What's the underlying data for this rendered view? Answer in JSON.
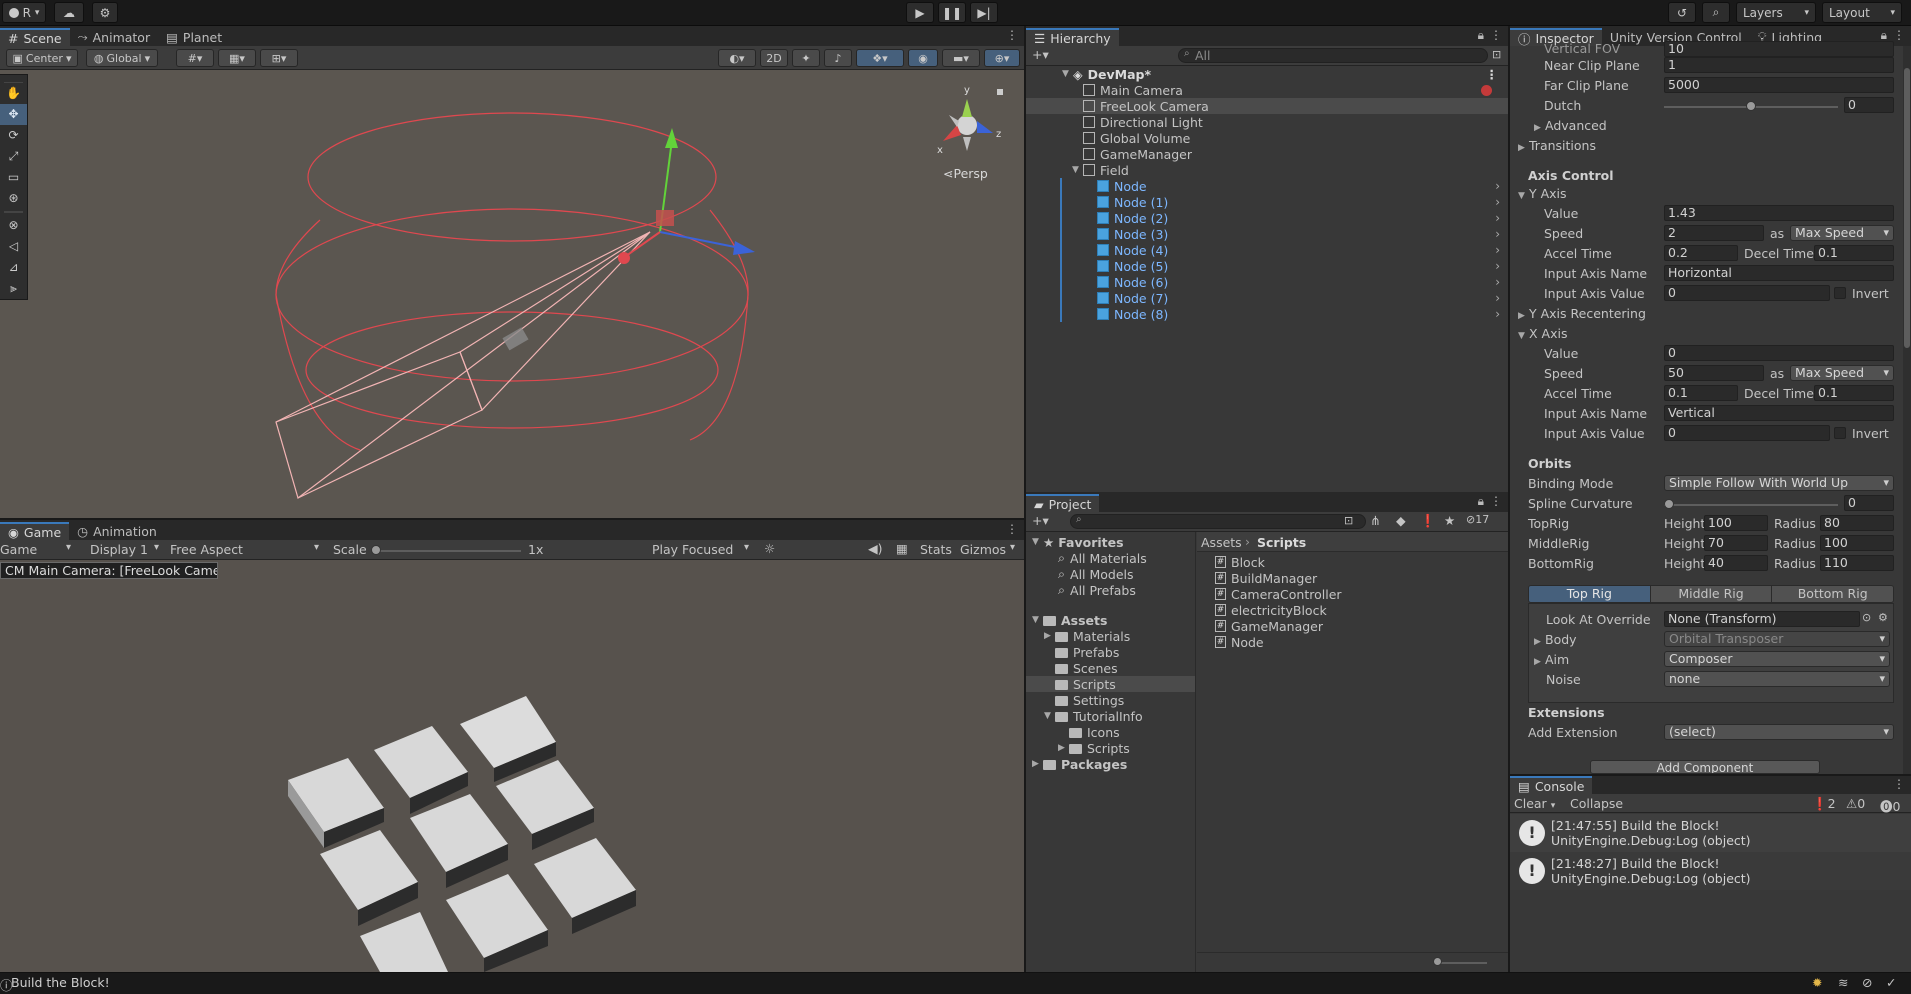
{
  "topbar": {
    "account_label": "R",
    "layers_label": "Layers",
    "layout_label": "Layout"
  },
  "scene": {
    "tabs": [
      "Scene",
      "Animator",
      "Planet"
    ],
    "pivot_label": "Center",
    "space_label": "Global",
    "mode_2d": "2D",
    "persp_label": "Persp"
  },
  "game": {
    "tabs": [
      "Game",
      "Animation"
    ],
    "display_target": "Game",
    "display": "Display 1",
    "aspect": "Free Aspect",
    "scale_label": "Scale",
    "scale_value": "1x",
    "play_mode": "Play Focused",
    "stats_label": "Stats",
    "gizmos_label": "Gizmos",
    "camera_tooltip": "CM Main Camera: [FreeLook Camera]"
  },
  "hierarchy": {
    "title": "Hierarchy",
    "search_placeholder": "All",
    "scene_name": "DevMap*",
    "items": [
      {
        "label": "Main Camera",
        "depth": 1,
        "prefab": false
      },
      {
        "label": "FreeLook Camera",
        "depth": 1,
        "prefab": false,
        "selected": true
      },
      {
        "label": "Directional Light",
        "depth": 1,
        "prefab": false
      },
      {
        "label": "Global Volume",
        "depth": 1,
        "prefab": false
      },
      {
        "label": "GameManager",
        "depth": 1,
        "prefab": false
      },
      {
        "label": "Field",
        "depth": 1,
        "prefab": false,
        "expanded": true
      },
      {
        "label": "Node",
        "depth": 2,
        "prefab": true
      },
      {
        "label": "Node (1)",
        "depth": 2,
        "prefab": true
      },
      {
        "label": "Node (2)",
        "depth": 2,
        "prefab": true
      },
      {
        "label": "Node (3)",
        "depth": 2,
        "prefab": true
      },
      {
        "label": "Node (4)",
        "depth": 2,
        "prefab": true
      },
      {
        "label": "Node (5)",
        "depth": 2,
        "prefab": true
      },
      {
        "label": "Node (6)",
        "depth": 2,
        "prefab": true
      },
      {
        "label": "Node (7)",
        "depth": 2,
        "prefab": true
      },
      {
        "label": "Node (8)",
        "depth": 2,
        "prefab": true
      }
    ]
  },
  "project": {
    "title": "Project",
    "hidden_count": "17",
    "favorites_label": "Favorites",
    "favorites": [
      "All Materials",
      "All Models",
      "All Prefabs"
    ],
    "assets_label": "Assets",
    "asset_folders": [
      {
        "label": "Materials",
        "depth": 1
      },
      {
        "label": "Prefabs",
        "depth": 1
      },
      {
        "label": "Scenes",
        "depth": 1
      },
      {
        "label": "Scripts",
        "depth": 1,
        "selected": true
      },
      {
        "label": "Settings",
        "depth": 1
      },
      {
        "label": "TutorialInfo",
        "depth": 1
      },
      {
        "label": "Icons",
        "depth": 2
      },
      {
        "label": "Scripts",
        "depth": 2
      }
    ],
    "packages_label": "Packages",
    "breadcrumb": [
      "Assets",
      "Scripts"
    ],
    "files": [
      "Block",
      "BuildManager",
      "CameraController",
      "electricityBlock",
      "GameManager",
      "Node"
    ]
  },
  "inspector": {
    "tabs": [
      "Inspector",
      "Unity Version Control",
      "Lighting"
    ],
    "vertical_fov_label": "Vertical FOV",
    "vertical_fov_value": "10",
    "near_clip_label": "Near Clip Plane",
    "near_clip_value": "1",
    "far_clip_label": "Far Clip Plane",
    "far_clip_value": "5000",
    "dutch_label": "Dutch",
    "dutch_value": "0",
    "advanced_label": "Advanced",
    "transitions_label": "Transitions",
    "axis_control_label": "Axis Control",
    "y_axis": {
      "label": "Y Axis",
      "value_label": "Value",
      "value": "1.43",
      "speed_label": "Speed",
      "speed": "2",
      "as_label": "as",
      "speed_mode": "Max Speed",
      "accel_label": "Accel Time",
      "accel": "0.2",
      "decel_label": "Decel Time",
      "decel": "0.1",
      "input_name_label": "Input Axis Name",
      "input_name": "Horizontal",
      "input_value_label": "Input Axis Value",
      "input_value": "0",
      "invert_label": "Invert"
    },
    "y_recentering_label": "Y Axis Recentering",
    "x_axis": {
      "label": "X Axis",
      "value_label": "Value",
      "value": "0",
      "speed_label": "Speed",
      "speed": "50",
      "as_label": "as",
      "speed_mode": "Max Speed",
      "accel_label": "Accel Time",
      "accel": "0.1",
      "decel_label": "Decel Time",
      "decel": "0.1",
      "input_name_label": "Input Axis Name",
      "input_name": "Vertical",
      "input_value_label": "Input Axis Value",
      "input_value": "0",
      "invert_label": "Invert"
    },
    "orbits_label": "Orbits",
    "binding_mode_label": "Binding Mode",
    "binding_mode": "Simple Follow With World Up",
    "spline_label": "Spline Curvature",
    "spline_value": "0",
    "height_label": "Height",
    "radius_label": "Radius",
    "rigs": [
      {
        "label": "TopRig",
        "height": "100",
        "radius": "80"
      },
      {
        "label": "MiddleRig",
        "height": "70",
        "radius": "100"
      },
      {
        "label": "BottomRig",
        "height": "40",
        "radius": "110"
      }
    ],
    "rig_tabs": [
      "Top Rig",
      "Middle Rig",
      "Bottom Rig"
    ],
    "look_at_label": "Look At Override",
    "look_at_value": "None (Transform)",
    "body_label": "Body",
    "body_value": "Orbital Transposer",
    "aim_label": "Aim",
    "aim_value": "Composer",
    "noise_label": "Noise",
    "noise_value": "none",
    "extensions_label": "Extensions",
    "add_extension_label": "Add Extension",
    "add_extension_value": "(select)",
    "add_component_label": "Add Component"
  },
  "console": {
    "title": "Console",
    "clear_label": "Clear",
    "collapse_label": "Collapse",
    "log_count": "2",
    "warn_count": "0",
    "error_count": "0",
    "entries": [
      {
        "line1": "[21:47:55] Build the Block!",
        "line2": "UnityEngine.Debug:Log (object)"
      },
      {
        "line1": "[21:48:27] Build the Block!",
        "line2": "UnityEngine.Debug:Log (object)"
      }
    ]
  },
  "statusbar": {
    "message": "Build the Block!"
  },
  "colors": {
    "accent": "#3a79bb",
    "selection": "#2c5d87",
    "prefab_text": "#7db7ff",
    "gizmo_red": "#e0484f"
  }
}
